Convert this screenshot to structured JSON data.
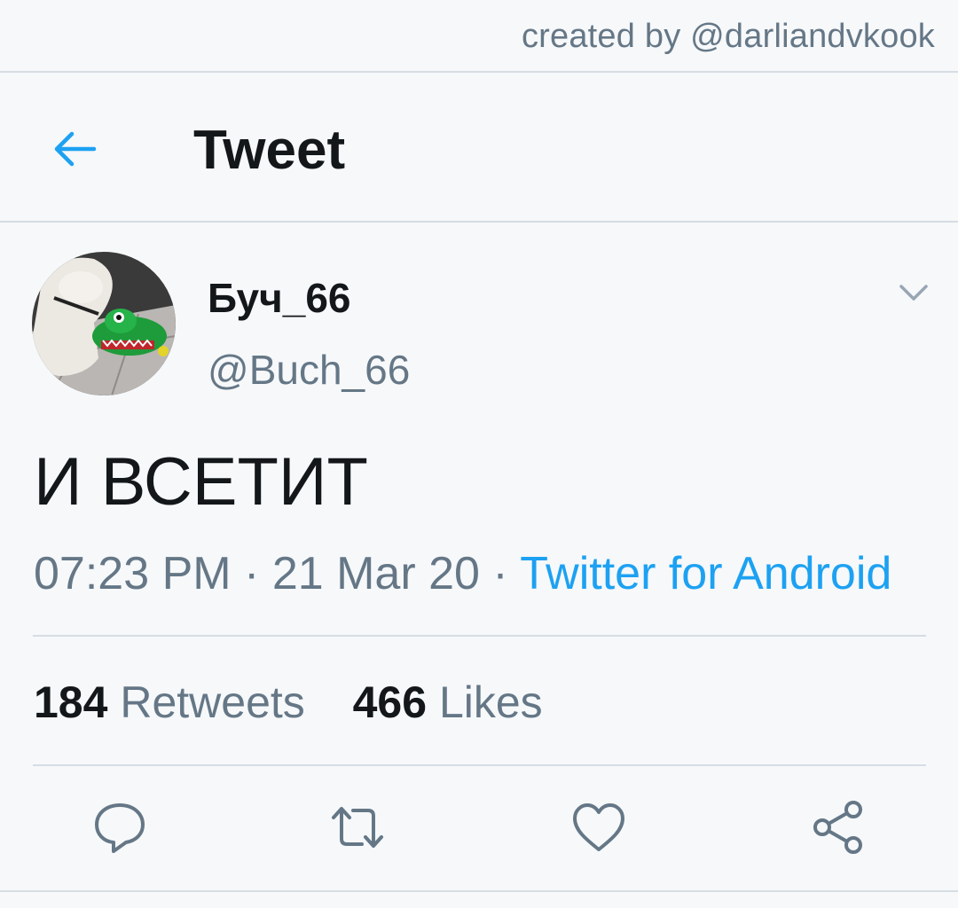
{
  "watermark": "created by @darliandvkook",
  "header": {
    "title": "Tweet",
    "back_icon": "arrow-left-icon"
  },
  "tweet": {
    "author": {
      "display_name": "Буч_66",
      "handle": "@Buch_66",
      "avatar": "avatar-dog-with-crocodile-toy"
    },
    "text": "И ВСЕТИТ",
    "time": "07:23 PM",
    "date": "21 Mar 20",
    "separator": "·",
    "source": "Twitter for Android",
    "stats": {
      "retweets_count": "184",
      "retweets_label": "Retweets",
      "likes_count": "466",
      "likes_label": "Likes"
    }
  },
  "actions": [
    "reply-icon",
    "retweet-icon",
    "like-icon",
    "share-icon"
  ],
  "colors": {
    "accent": "#1da1f2",
    "secondary_text": "#657786",
    "primary_text": "#14171a",
    "background": "#f6f8fa",
    "divider": "#d6dde3"
  }
}
